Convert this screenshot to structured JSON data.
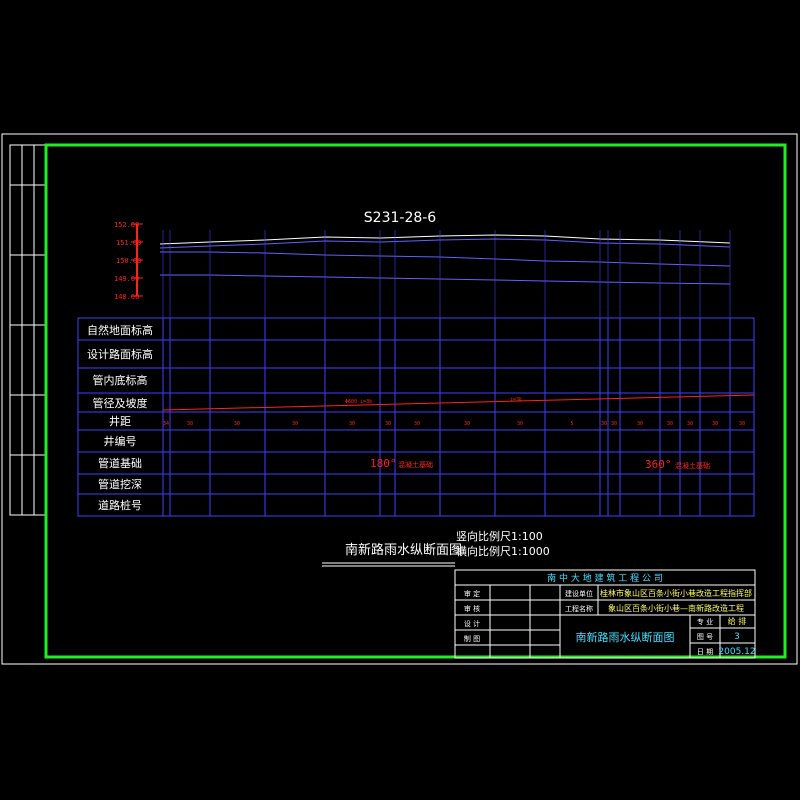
{
  "drawing": {
    "number": "S231-28-6",
    "elevation_ticks": [
      "152.00",
      "151.00",
      "150.00",
      "149.00",
      "148.00"
    ],
    "row_labels": [
      "自然地面标高",
      "设计路面标高",
      "管内底标高",
      "管径及坡度",
      "井距",
      "井编号",
      "管道基础",
      "管道挖深",
      "道路桩号"
    ],
    "pipe_spec_left": "Φ600 i=3‰",
    "pipe_spec_right": "i=3‰",
    "distances": [
      "34",
      "30",
      "30",
      "30",
      "30",
      "30",
      "30",
      "30",
      "30",
      "5",
      "30",
      "30",
      "30",
      "30",
      "30",
      "30",
      "30"
    ],
    "foundation_left_angle": "180°",
    "foundation_left_text": "混凝土基础",
    "foundation_right_angle": "360°",
    "foundation_right_text": "混凝土基础",
    "section_title": "南新路雨水纵断面图",
    "vertical_scale": "竖向比例尺1:100",
    "horizontal_scale": "横向比例尺1:1000"
  },
  "title_block": {
    "company": "南 中 大 地 建 筑 工 程 公 司",
    "row1_label": "审 定",
    "row2_label": "审 核",
    "row3_label": "设 计",
    "row4_label": "制 图",
    "build_unit_label": "建设单位",
    "build_unit_value": "桂林市象山区百条小街小巷改造工程指挥部",
    "project_label": "工程名称",
    "project_value": "象山区百条小街小巷—南新路改造工程",
    "drawing_name": "南新路雨水纵断面图",
    "spec_label": "专 业",
    "spec_value": "给 排",
    "sheet_label": "图 号",
    "sheet_value": "3",
    "date_label": "日 期",
    "date_value": "2005.12"
  }
}
